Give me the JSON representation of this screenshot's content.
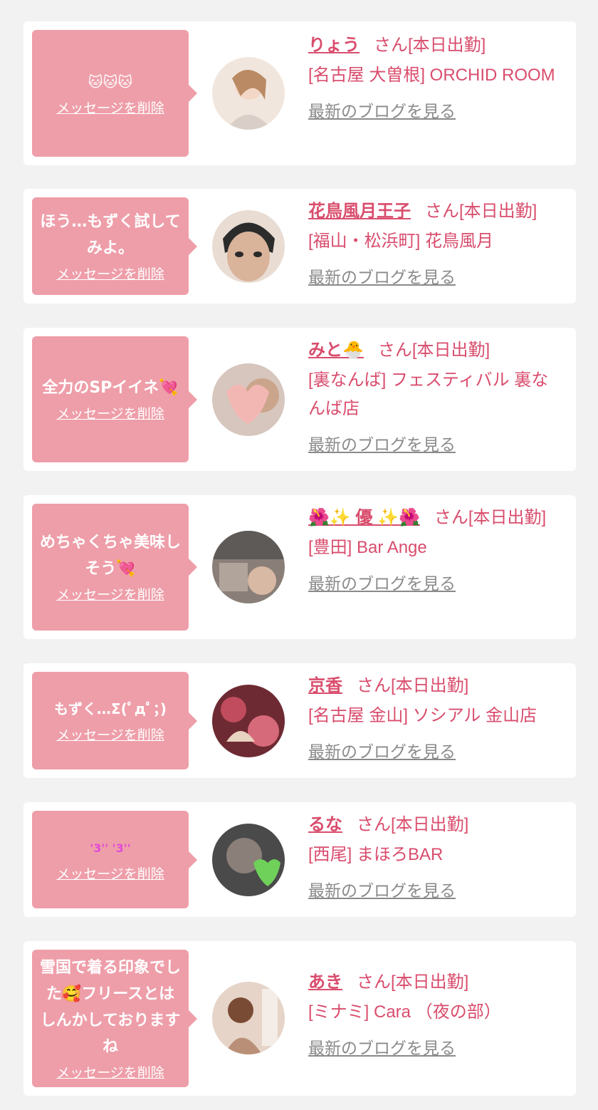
{
  "delete_label": "メッセージを削除",
  "blog_label": "最新のブログを見る",
  "colors": {
    "background": "#f2f2f2",
    "bubble": "#ee9ea9",
    "accent": "#d94d6d",
    "link_gray": "#8a8a8a"
  },
  "items": [
    {
      "message": "🐱🐱🐱",
      "name": "りょう",
      "status": "さん[本日出勤]",
      "shop": "[名古屋 大曽根] ORCHID ROOM"
    },
    {
      "message": "ほう…もずく試してみよ。",
      "name": "花鳥風月王子",
      "status": "さん[本日出勤]",
      "shop": "[福山・松浜町] 花鳥風月"
    },
    {
      "message": "全力のSPイイネ💘",
      "name": "みと🐣",
      "status": "さん[本日出勤]",
      "shop": "[裏なんば] フェスティバル 裏なんば店"
    },
    {
      "message": "めちゃくちゃ美味しそう💘",
      "name": "🌺✨ 優 ✨🌺",
      "status": "さん[本日出勤]",
      "shop": "[豊田] Bar Ange"
    },
    {
      "message": "もずく…Σ(ﾟдﾟ；)",
      "name": "京香",
      "status": "さん[本日出勤]",
      "shop": "[名古屋 金山] ソシアル 金山店"
    },
    {
      "message": "'3'' '3''",
      "name": "るな",
      "status": "さん[本日出勤]",
      "shop": "[西尾] まほろBAR"
    },
    {
      "message": "雪国で着る印象でした🥰フリースとはしんかしておりますね",
      "name": "あき",
      "status": "さん[本日出勤]",
      "shop": "[ミナミ] Cara （夜の部）"
    }
  ]
}
